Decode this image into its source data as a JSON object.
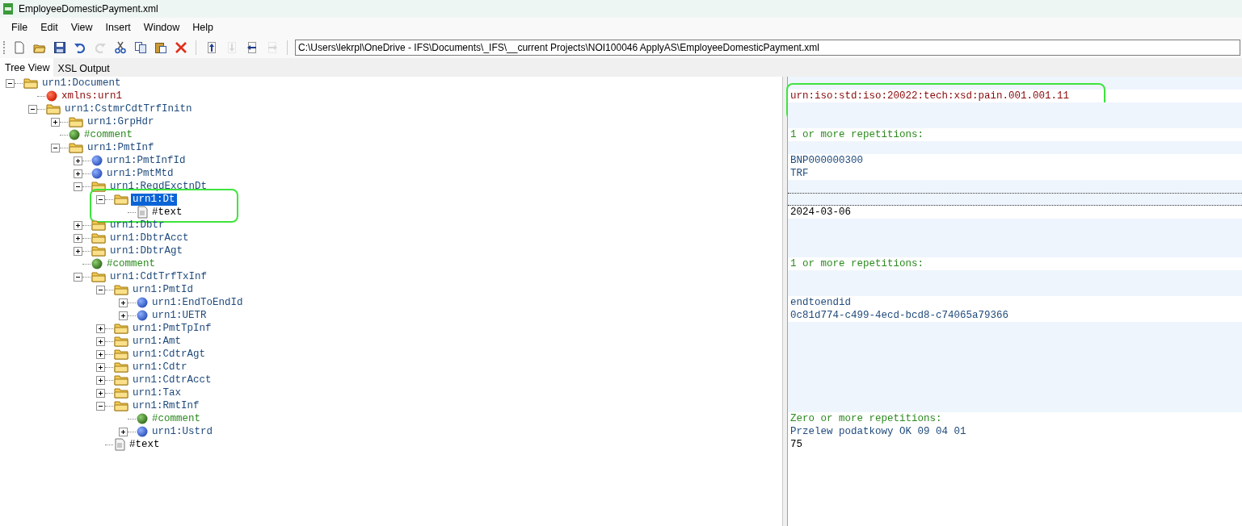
{
  "window": {
    "title": "EmployeeDomesticPayment.xml"
  },
  "menu": [
    "File",
    "Edit",
    "View",
    "Insert",
    "Window",
    "Help"
  ],
  "toolbar": [
    {
      "kind": "new",
      "disabled": false
    },
    {
      "kind": "open",
      "disabled": false
    },
    {
      "kind": "save",
      "disabled": false
    },
    {
      "kind": "undo",
      "disabled": false
    },
    {
      "kind": "redo",
      "disabled": true
    },
    {
      "kind": "cut",
      "disabled": false
    },
    {
      "kind": "copy",
      "disabled": false
    },
    {
      "kind": "paste",
      "disabled": false
    },
    {
      "kind": "delete",
      "disabled": false
    },
    {
      "kind": "move-up",
      "disabled": false
    },
    {
      "kind": "move-down",
      "disabled": true
    },
    {
      "kind": "move-left",
      "disabled": false
    },
    {
      "kind": "move-right",
      "disabled": true
    }
  ],
  "path": "C:\\Users\\lekrpl\\OneDrive - IFS\\Documents\\_IFS\\__current Projects\\NOI100046 ApplyAS\\EmployeeDomesticPayment.xml",
  "tabs": [
    {
      "label": "Tree View",
      "selected": true
    },
    {
      "label": "XSL Output",
      "selected": false
    }
  ],
  "tree": [
    {
      "kind": "folder",
      "label": "urn1:Document",
      "expanded": true,
      "selected": false,
      "children": [
        {
          "kind": "attribute",
          "label": "xmlns:urn1",
          "selected": false,
          "value": "urn:iso:std:iso:20022:tech:xsd:pain.001.001.11",
          "value_circled": true
        },
        {
          "kind": "folder",
          "label": "urn1:CstmrCdtTrfInitn",
          "expanded": true,
          "selected": false,
          "value_circled": true,
          "children": [
            {
              "kind": "folder",
              "label": "urn1:GrpHdr",
              "expanded": false,
              "selected": false
            },
            {
              "kind": "comment",
              "label": "#comment",
              "selected": false,
              "value": "1 or more repetitions:"
            },
            {
              "kind": "folder",
              "label": "urn1:PmtInf",
              "expanded": true,
              "selected": false,
              "children": [
                {
                  "kind": "element",
                  "label": "urn1:PmtInfId",
                  "expanded": false,
                  "selected": false,
                  "value": "BNP000000300"
                },
                {
                  "kind": "element",
                  "label": "urn1:PmtMtd",
                  "expanded": false,
                  "selected": false,
                  "value": "TRF"
                },
                {
                  "kind": "folder",
                  "label": "urn1:ReqdExctnDt",
                  "expanded": true,
                  "selected": false,
                  "children": [
                    {
                      "kind": "folder",
                      "label": "urn1:Dt",
                      "expanded": true,
                      "selected": true,
                      "circled": true,
                      "children": [
                        {
                          "kind": "text",
                          "label": "#text",
                          "selected": false,
                          "circled": true,
                          "value": "2024-03-06"
                        }
                      ]
                    }
                  ]
                },
                {
                  "kind": "folder",
                  "label": "urn1:Dbtr",
                  "expanded": false,
                  "selected": false
                },
                {
                  "kind": "folder",
                  "label": "urn1:DbtrAcct",
                  "expanded": false,
                  "selected": false
                },
                {
                  "kind": "folder",
                  "label": "urn1:DbtrAgt",
                  "expanded": false,
                  "selected": false
                },
                {
                  "kind": "comment",
                  "label": "#comment",
                  "selected": false,
                  "value": "1 or more repetitions:"
                },
                {
                  "kind": "folder",
                  "label": "urn1:CdtTrfTxInf",
                  "expanded": true,
                  "selected": false,
                  "children": [
                    {
                      "kind": "folder",
                      "label": "urn1:PmtId",
                      "expanded": true,
                      "selected": false,
                      "children": [
                        {
                          "kind": "element",
                          "label": "urn1:EndToEndId",
                          "expanded": false,
                          "selected": false,
                          "value": "endtoendid"
                        },
                        {
                          "kind": "element",
                          "label": "urn1:UETR",
                          "expanded": false,
                          "selected": false,
                          "value": "0c81d774-c499-4ecd-bcd8-c74065a79366"
                        }
                      ]
                    },
                    {
                      "kind": "folder",
                      "label": "urn1:PmtTpInf",
                      "expanded": false,
                      "selected": false
                    },
                    {
                      "kind": "folder",
                      "label": "urn1:Amt",
                      "expanded": false,
                      "selected": false
                    },
                    {
                      "kind": "folder",
                      "label": "urn1:CdtrAgt",
                      "expanded": false,
                      "selected": false
                    },
                    {
                      "kind": "folder",
                      "label": "urn1:Cdtr",
                      "expanded": false,
                      "selected": false
                    },
                    {
                      "kind": "folder",
                      "label": "urn1:CdtrAcct",
                      "expanded": false,
                      "selected": false
                    },
                    {
                      "kind": "folder",
                      "label": "urn1:Tax",
                      "expanded": false,
                      "selected": false
                    },
                    {
                      "kind": "folder",
                      "label": "urn1:RmtInf",
                      "expanded": true,
                      "selected": false,
                      "children": [
                        {
                          "kind": "comment",
                          "label": "#comment",
                          "selected": false,
                          "value": "Zero or more repetitions:"
                        },
                        {
                          "kind": "element",
                          "label": "urn1:Ustrd",
                          "expanded": false,
                          "selected": false,
                          "value": "Przelew podatkowy OK 09 04 01"
                        }
                      ]
                    },
                    {
                      "kind": "text",
                      "label": "#text",
                      "selected": false,
                      "value": "75"
                    }
                  ]
                }
              ]
            }
          ]
        }
      ]
    }
  ]
}
